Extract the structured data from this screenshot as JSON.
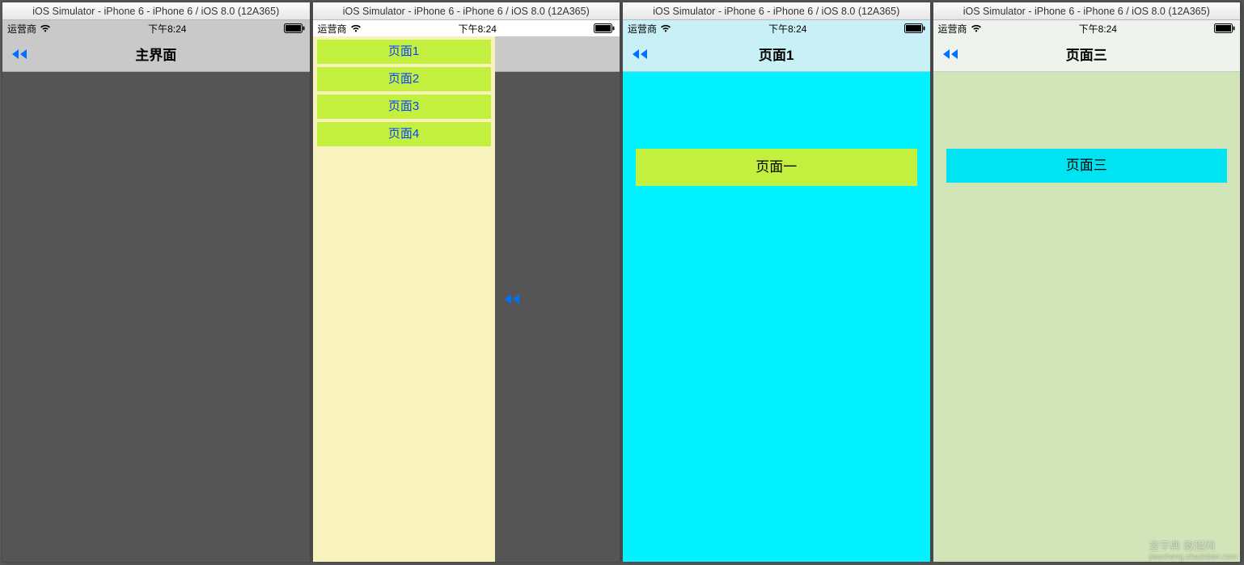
{
  "window_title": "iOS Simulator - iPhone 6 - iPhone 6 / iOS 8.0 (12A365)",
  "status": {
    "carrier": "运营商",
    "time": "下午8:24"
  },
  "screen1": {
    "nav_title": "主界面"
  },
  "screen2": {
    "menu_items": [
      "页面1",
      "页面2",
      "页面3",
      "页面4"
    ]
  },
  "screen3": {
    "nav_title": "页面1",
    "page_label": "页面一"
  },
  "screen4": {
    "nav_title": "页面三",
    "page_label": "页面三"
  },
  "watermark": {
    "main": "查字典 教程网",
    "sub": "jiaocheng.chazidian.com"
  }
}
